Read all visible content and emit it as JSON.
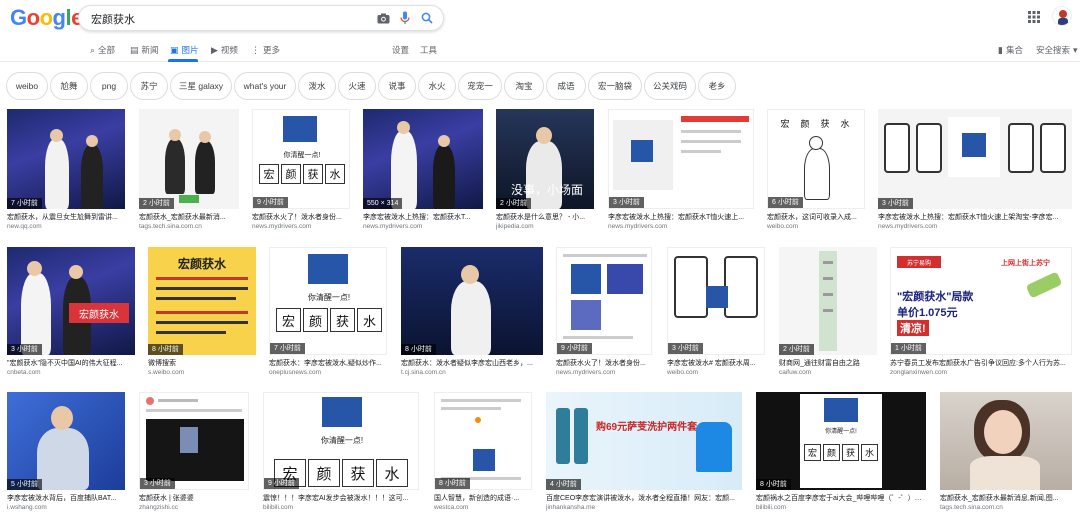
{
  "logo": "Google",
  "search": {
    "query": "宏颜获水"
  },
  "icons": {
    "camera": "camera-icon",
    "mic": "mic-icon",
    "search": "search-icon",
    "apps": "apps-grid-icon"
  },
  "nav": {
    "tabs": [
      {
        "label": "全部",
        "icon": "search-icon"
      },
      {
        "label": "新闻",
        "icon": "news-icon"
      },
      {
        "label": "图片",
        "icon": "image-icon"
      },
      {
        "label": "视频",
        "icon": "video-icon"
      },
      {
        "label": "更多",
        "icon": "more-icon"
      }
    ],
    "settings": "设置",
    "tools": "工具",
    "collections": "集合",
    "safesearch": "安全搜索"
  },
  "chips": [
    "weibo",
    "尬舞",
    "png",
    "苏宁",
    "三星 galaxy",
    "what's your",
    "泼水",
    "火速",
    "说事",
    "水火",
    "宠宠一",
    "淘宝",
    "成语",
    "宏一脑袋",
    "公关戏码",
    "老乡"
  ],
  "results": [
    {
      "time": "7 小时前",
      "caption": "宏颜获水，从震旦女生尬舞到雷讲...",
      "source": "new.qq.com"
    },
    {
      "time": "2 小时前",
      "caption": "宏颜获水_宏颜获水最新消...",
      "source": "tags.tech.sina.com.cn"
    },
    {
      "time": "9 小时前",
      "caption": "宏颜获水火了！泼水者身份...",
      "source": "news.mydrivers.com"
    },
    {
      "time": "550 × 314",
      "caption": "李彦宏被泼水上热搜：宏颜获水T...",
      "source": "news.mydrivers.com"
    },
    {
      "time": "2 小时前",
      "caption": "宏颜获水是什么意思？ - 小...",
      "source": "jikipedia.com",
      "overlay": "没事，小场面"
    },
    {
      "time": "3 小时前",
      "caption": "李彦宏被泼水上热搜：宏颜获水T恤火速上...",
      "source": "news.mydrivers.com"
    },
    {
      "time": "6 小时前",
      "caption": "宏颜获水，这词可收录入成...",
      "source": "weibo.com"
    },
    {
      "time": "3 小时前",
      "caption": "李彦宏被泼水上热搜：宏颜获水T恤火速上架淘宝-李彦宏...",
      "source": "news.mydrivers.com"
    },
    {
      "time": "3 小时前",
      "caption": "\"宏颜获水\"隐不灭中国AI的伟大征程...",
      "source": "cnbeta.com",
      "overlay": "宏颜获水"
    },
    {
      "time": "8 小时前",
      "caption": "微博搜索",
      "source": "s.weibo.com",
      "overlay": "宏颜获水"
    },
    {
      "time": "7 小时前",
      "caption": "宏颜获水：李彦宏被泼水,疑似炒作...",
      "source": "oneplusnews.com"
    },
    {
      "time": "8 小时前",
      "caption": "宏颜获水：泼水者疑似李彦宏山西老乡，...",
      "source": "t.cj.sina.com.cn"
    },
    {
      "time": "9 小时前",
      "caption": "宏颜获水火了！泼水者身份...",
      "source": "news.mydrivers.com"
    },
    {
      "time": "3 小时前",
      "caption": "李彦宏被泼水# 宏颜获水周...",
      "source": "weibo.com"
    },
    {
      "time": "2 小时前",
      "caption": "财商网_通往财富自由之路",
      "source": "caifuw.com"
    },
    {
      "time": "1 小时前",
      "caption": "苏宁春员工发布宏颜获水广告引争议回应:多个人行为苏...",
      "source": "zonglanxinwen.com",
      "overlay": "\"宏颜获水\"局款单价1.075元清凉!"
    },
    {
      "time": "5 小时前",
      "caption": "李彦宏被泼水背后，百度捕队BAT...",
      "source": "i.wshang.com"
    },
    {
      "time": "3 小时前",
      "caption": "宏颜获水 | 张婆婆",
      "source": "zhangzishi.cc"
    },
    {
      "time": "9 小时前",
      "caption": "震惊！！！李彦宏AI发步会被泼水！！！这可...",
      "source": "bilibili.com"
    },
    {
      "time": "8 小时前",
      "caption": "国人智慧，新创造的成语·...",
      "source": "westca.com"
    },
    {
      "time": "4 小时前",
      "caption": "百度CEO李彦宏演讲被泼水，泼水者全程直播！网友：宏颜...",
      "source": "jinhankansha.me",
      "overlay": "购69元萨芰洗护两件套"
    },
    {
      "time": "8 小时前",
      "caption": "宏颜祸水之百度李彦宏于ai大会_哔哩哔哩（゜-゜）つ...",
      "source": "bilibili.com"
    },
    {
      "time": "",
      "caption": "宏颜获水_宏颜获水最新消息,新闻,图...",
      "source": "tags.tech.sina.com.cn"
    }
  ],
  "overlays": {
    "wake_up": "你清醒一点!",
    "chars": [
      "宏",
      "颜",
      "获",
      "水"
    ],
    "price_line1": "\"宏颜获水\"局款",
    "price_line2": "单价1.075元",
    "price_line3": "清凉!",
    "tagline": "上网上街上苏宁",
    "suning": "苏宁易购"
  },
  "colors": {
    "accent": "#1a73e8",
    "stage": "#2a3590"
  }
}
